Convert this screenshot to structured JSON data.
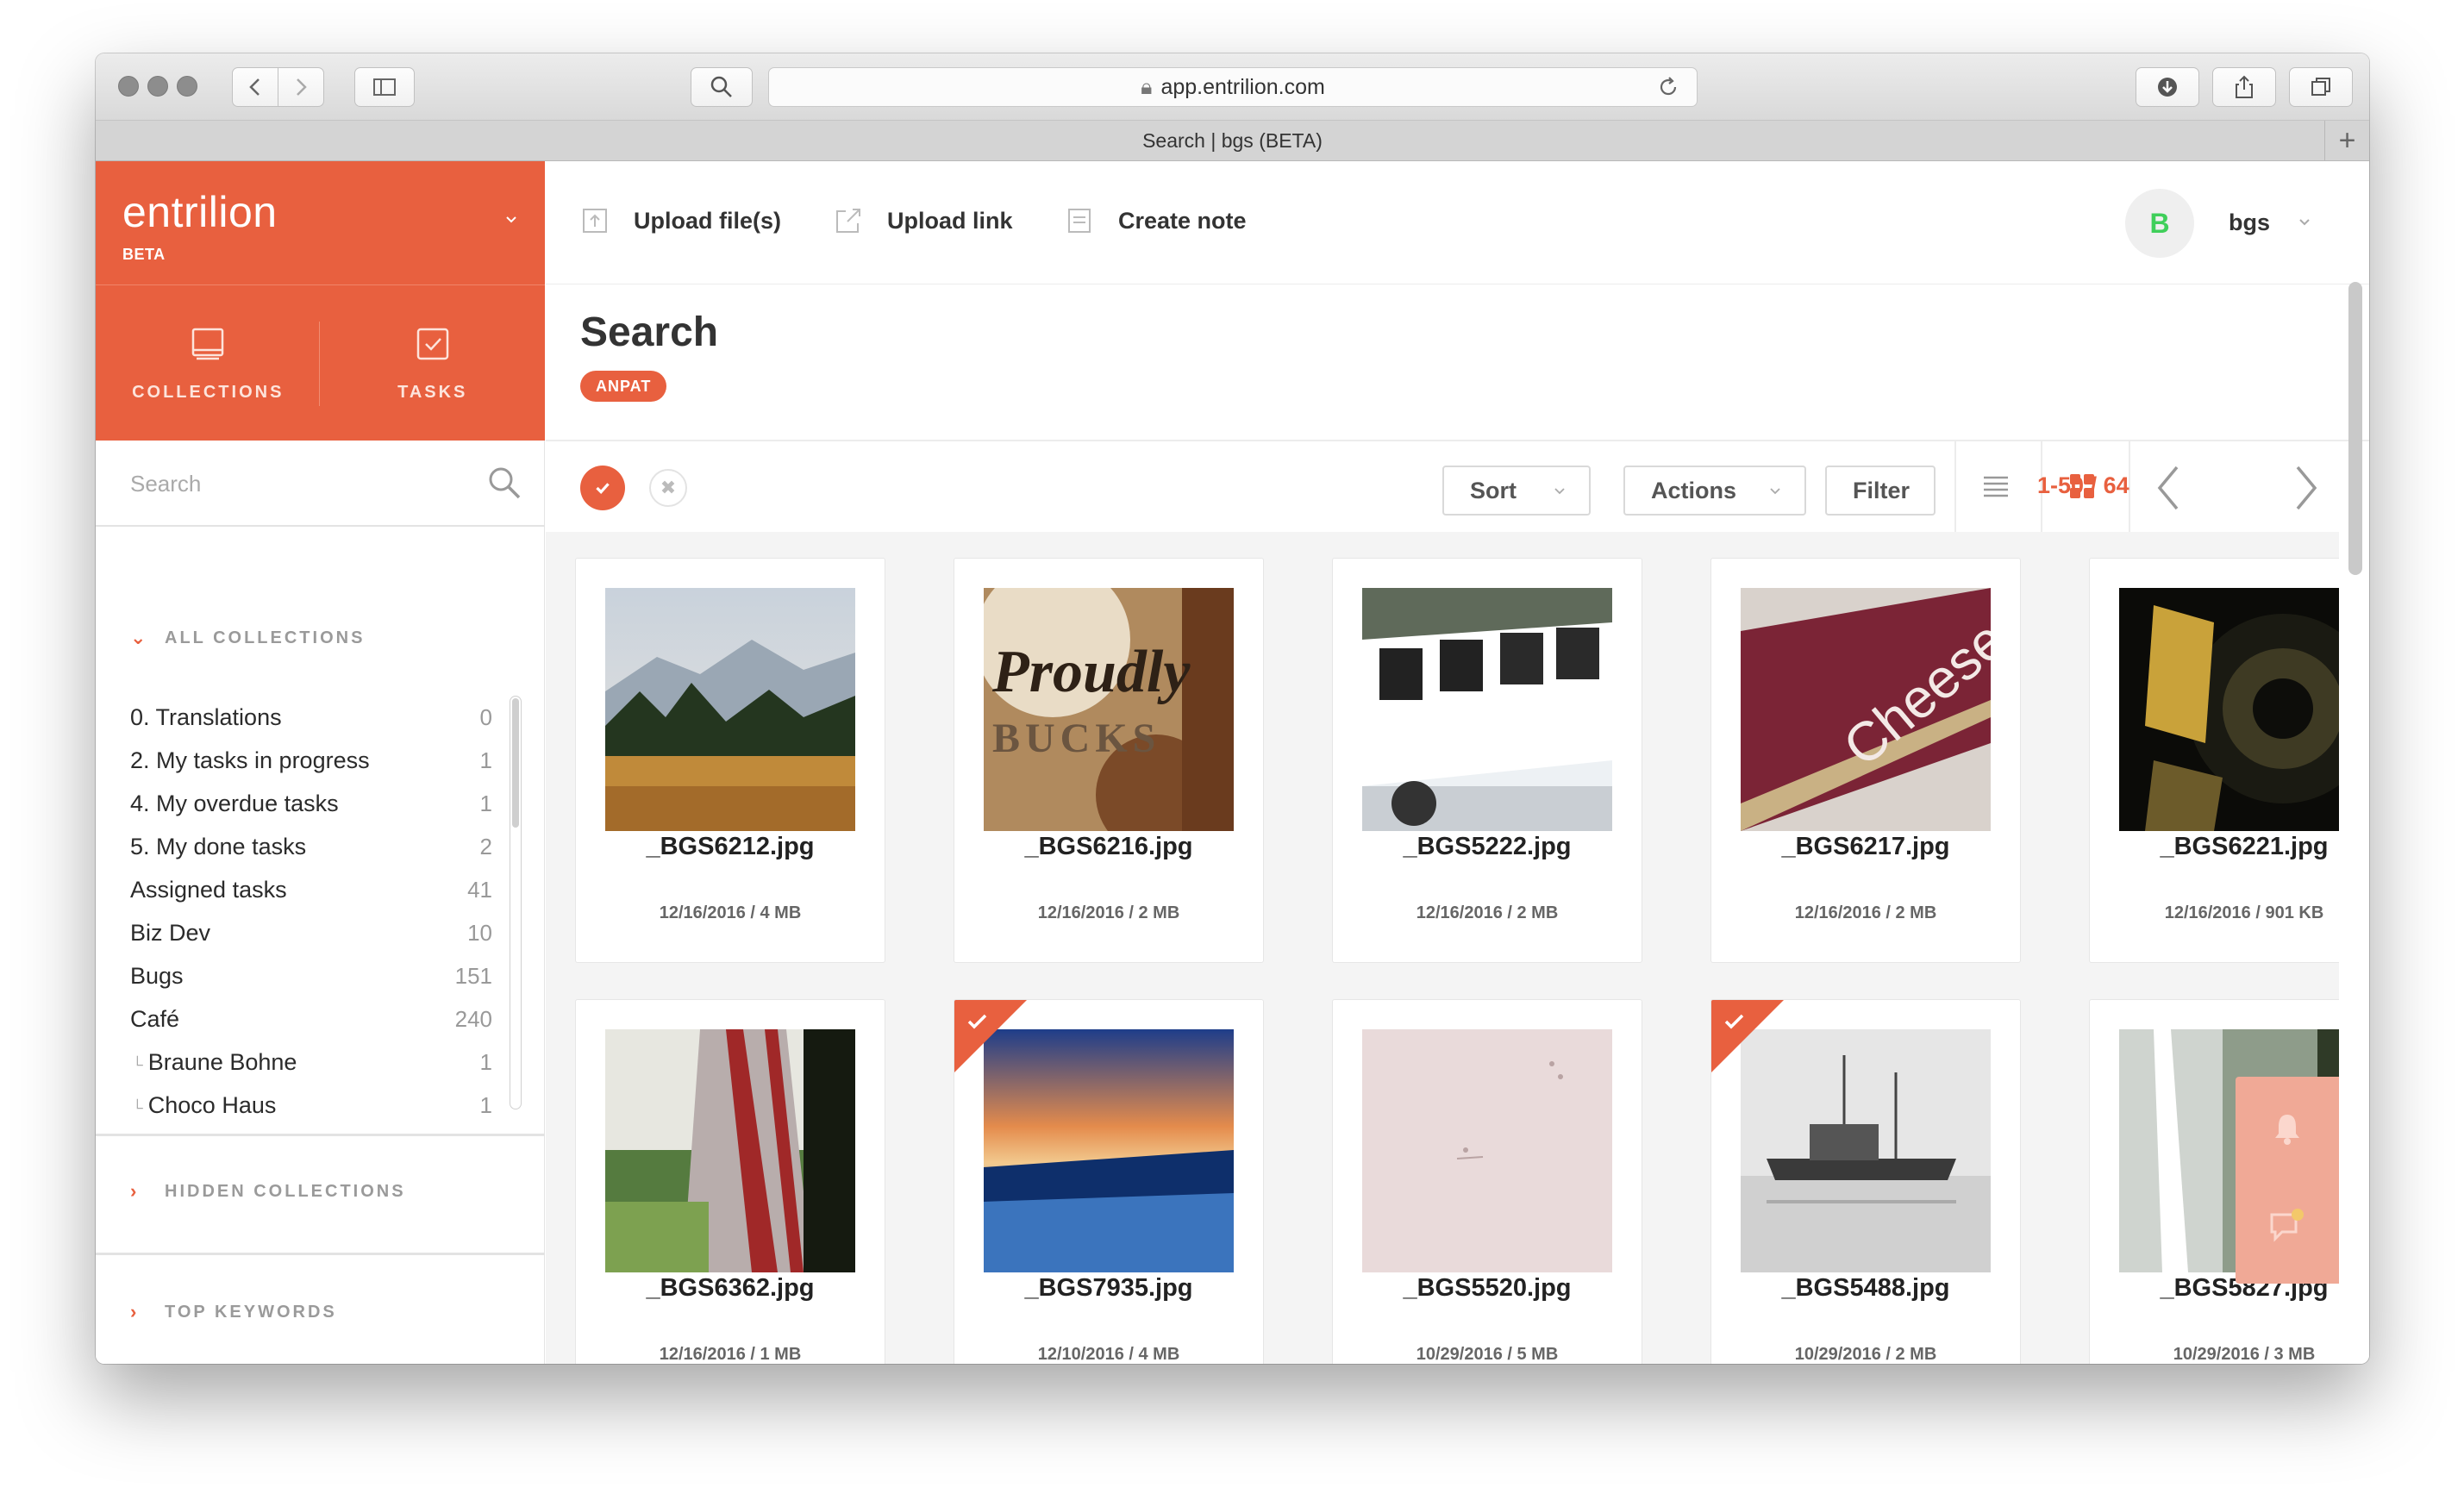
{
  "browser": {
    "url": "app.entrilion.com",
    "tab_title": "Search | bgs (BETA)"
  },
  "brand": {
    "name": "entrilion",
    "badge": "BETA"
  },
  "nav": {
    "collections": "COLLECTIONS",
    "tasks": "TASKS"
  },
  "sidebar": {
    "search_placeholder": "Search",
    "all_collections": "ALL COLLECTIONS",
    "hidden_collections": "HIDDEN COLLECTIONS",
    "top_keywords": "TOP KEYWORDS",
    "collections": [
      {
        "label": "0. Translations",
        "count": "0"
      },
      {
        "label": "2. My tasks in progress",
        "count": "1"
      },
      {
        "label": "4. My overdue tasks",
        "count": "1"
      },
      {
        "label": "5. My done tasks",
        "count": "2"
      },
      {
        "label": "Assigned tasks",
        "count": "41"
      },
      {
        "label": "Biz Dev",
        "count": "10"
      },
      {
        "label": "Bugs",
        "count": "151"
      },
      {
        "label": "Café",
        "count": "240"
      },
      {
        "label": "Braune Bohne",
        "count": "1"
      },
      {
        "label": "Choco Haus",
        "count": "1"
      }
    ]
  },
  "topbar": {
    "upload_files": "Upload file(s)",
    "upload_link": "Upload link",
    "create_note": "Create note",
    "avatar_letter": "B",
    "user": "bgs"
  },
  "page": {
    "title": "Search",
    "tag": "ANPAT"
  },
  "toolbar": {
    "sort": "Sort",
    "actions": "Actions",
    "filter": "Filter",
    "range": "1-50",
    "total": "/ 64"
  },
  "files": [
    {
      "name": "_BGS6212.jpg",
      "meta": "12/16/2016 / 4 MB",
      "selected": false
    },
    {
      "name": "_BGS6216.jpg",
      "meta": "12/16/2016 / 2 MB",
      "selected": false
    },
    {
      "name": "_BGS5222.jpg",
      "meta": "12/16/2016 / 2 MB",
      "selected": false
    },
    {
      "name": "_BGS6217.jpg",
      "meta": "12/16/2016 / 2 MB",
      "selected": false
    },
    {
      "name": "_BGS6221.jpg",
      "meta": "12/16/2016 / 901 KB",
      "selected": false
    },
    {
      "name": "_BGS6362.jpg",
      "meta": "12/16/2016 / 1 MB",
      "selected": false
    },
    {
      "name": "_BGS7935.jpg",
      "meta": "12/10/2016 / 4 MB",
      "selected": true
    },
    {
      "name": "_BGS5520.jpg",
      "meta": "10/29/2016 / 5 MB",
      "selected": false
    },
    {
      "name": "_BGS5488.jpg",
      "meta": "10/29/2016 / 2 MB",
      "selected": true
    },
    {
      "name": "_BGS5827.jpg",
      "meta": "10/29/2016 / 3 MB",
      "selected": false
    }
  ],
  "thumb_text": {
    "proudly": "Proudly",
    "bucks": "BUCKS",
    "cheese": "Cheese"
  },
  "colors": {
    "accent": "#e8603f",
    "accent_light": "#f0a996",
    "avatar_letter": "#3fcf5a"
  }
}
